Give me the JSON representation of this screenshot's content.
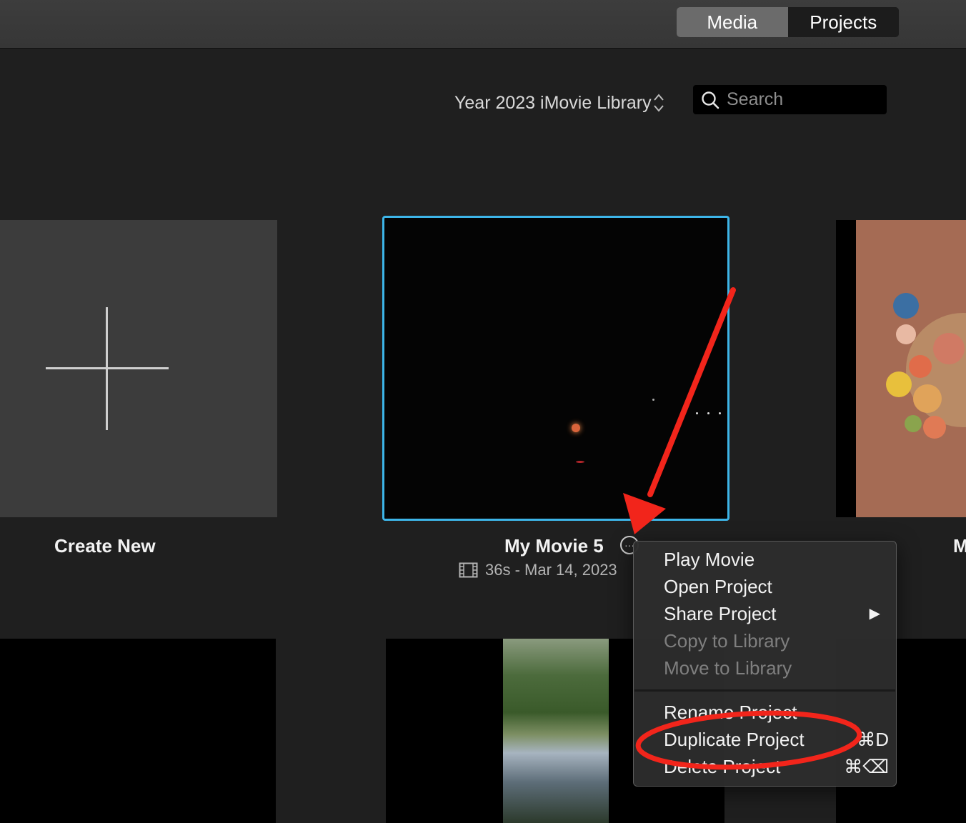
{
  "toolbar": {
    "tabs": [
      {
        "label": "Media",
        "active": true
      },
      {
        "label": "Projects",
        "active": false
      }
    ]
  },
  "library": {
    "selector_label": "Year 2023 iMovie Library",
    "selector_icon": "up-down-chevron-icon"
  },
  "search": {
    "placeholder": "Search",
    "value": ""
  },
  "projects": {
    "create_new_label": "Create New",
    "selected": {
      "title": "My Movie 5",
      "meta": "36s - Mar 14, 2023",
      "highlight_color": "#3db5e8"
    },
    "next_title_partial": "M"
  },
  "context_menu": {
    "items": [
      {
        "label": "Play Movie",
        "enabled": true
      },
      {
        "label": "Open Project",
        "enabled": true
      },
      {
        "label": "Share Project",
        "enabled": true,
        "submenu_glyph": "▶"
      },
      {
        "label": "Copy to Library",
        "enabled": false
      },
      {
        "label": "Move to Library",
        "enabled": false
      },
      {
        "label": "Rename Project",
        "enabled": true
      },
      {
        "label": "Duplicate Project",
        "enabled": true,
        "shortcut": "⌘D"
      },
      {
        "label": "Delete Project",
        "enabled": true,
        "shortcut": "⌘⌫"
      }
    ]
  },
  "annotations": {
    "arrow_color": "#f2251b",
    "ellipse_color": "#f2251b"
  }
}
